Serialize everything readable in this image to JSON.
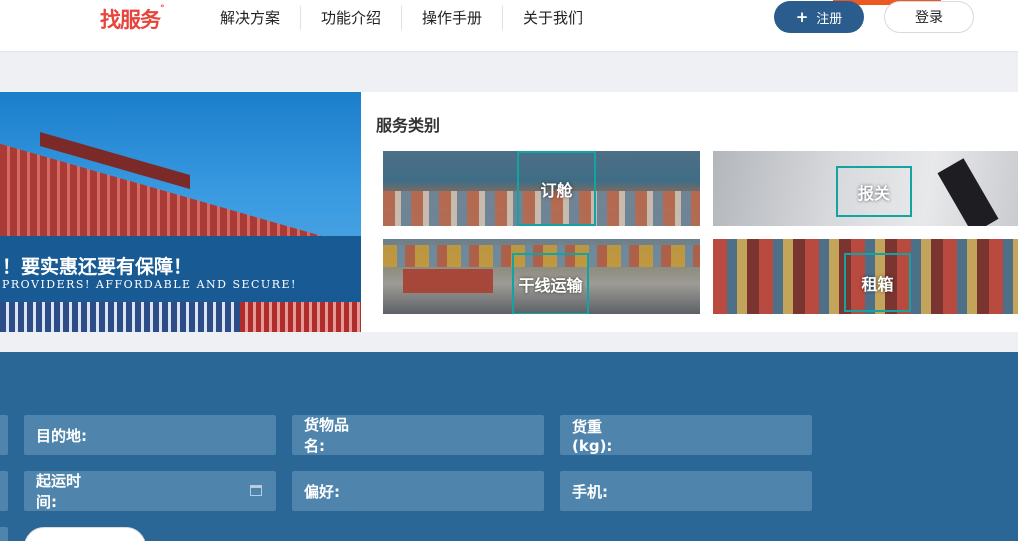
{
  "header": {
    "logo_text": "找服务",
    "logo_mark": "°",
    "nav": [
      "解决方案",
      "功能介绍",
      "操作手册",
      "关于我们"
    ],
    "register_label": "注册",
    "login_label": "登录"
  },
  "banner": {
    "headline_cn": "！要实惠还要有保障！",
    "headline_en": "PROVIDERS! AFFORDABLE AND SECURE!"
  },
  "services": {
    "title": "服务类别",
    "items": [
      {
        "label": "订舱"
      },
      {
        "label": "报关"
      },
      {
        "label": "干线运输"
      },
      {
        "label": "租箱"
      }
    ]
  },
  "form": {
    "destination_label": "目的地:",
    "cargo_name_label": "货物品名:",
    "weight_label": "货重(kg):",
    "departure_time_label": "起运时间:",
    "preference_label": "偏好:",
    "phone_label": "手机:"
  },
  "colors": {
    "brand_red": "#e8443c",
    "primary_blue": "#2a5d8e",
    "form_bg": "#2a6696",
    "field_bg": "#4f85ad",
    "accent_teal": "#13a3a3",
    "accent_orange": "#ec5a21"
  }
}
